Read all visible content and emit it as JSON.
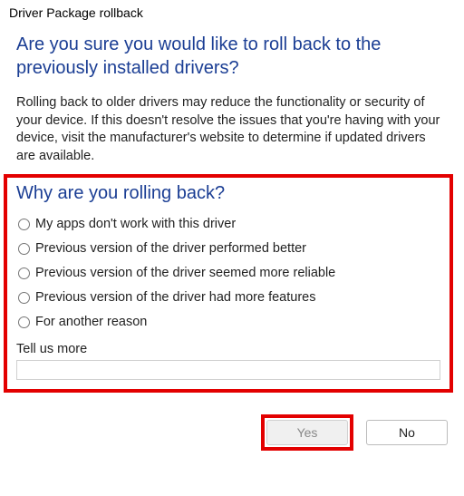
{
  "window": {
    "title": "Driver Package rollback"
  },
  "heading": "Are you sure you would like to roll back to the previously installed drivers?",
  "description": "Rolling back to older drivers may reduce the functionality or security of your device. If this doesn't resolve the issues that you're having with your device, visit the manufacturer's website to determine if updated drivers are available.",
  "subheading": "Why are you rolling back?",
  "reasons": [
    "My apps don't work with this driver",
    "Previous version of the driver performed better",
    "Previous version of the driver seemed more reliable",
    "Previous version of the driver had more features",
    "For another reason"
  ],
  "tell_more_label": "Tell us more",
  "tell_more_value": "",
  "buttons": {
    "yes": "Yes",
    "no": "No"
  }
}
